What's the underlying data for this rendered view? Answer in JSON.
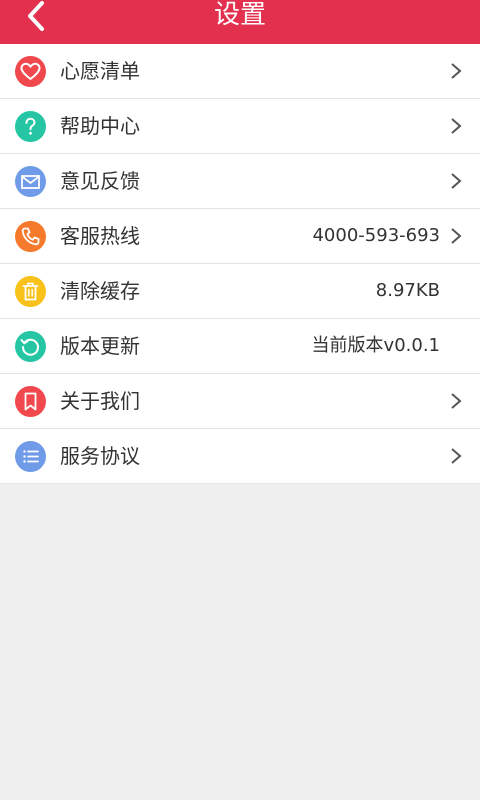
{
  "header": {
    "title": "设置",
    "back_icon": "chevron-left-icon",
    "background_color": "#e3304f"
  },
  "settings": {
    "items": [
      {
        "label": "心愿清单",
        "value": "",
        "icon": "heart-icon",
        "color": "#f0484c",
        "has_chevron": true
      },
      {
        "label": "帮助中心",
        "value": "",
        "icon": "question-icon",
        "color": "#26c6a4",
        "has_chevron": true
      },
      {
        "label": "意见反馈",
        "value": "",
        "icon": "mail-icon",
        "color": "#6f9be8",
        "has_chevron": true
      },
      {
        "label": "客服热线",
        "value": "4000-593-693",
        "icon": "phone-icon",
        "color": "#f57a2b",
        "has_chevron": true
      },
      {
        "label": "清除缓存",
        "value": "8.97KB",
        "icon": "trash-icon",
        "color": "#f8c21a",
        "has_chevron": false
      },
      {
        "label": "版本更新",
        "value": "当前版本v0.0.1",
        "icon": "refresh-icon",
        "color": "#26c6a4",
        "has_chevron": false
      },
      {
        "label": "关于我们",
        "value": "",
        "icon": "bookmark-icon",
        "color": "#f0484c",
        "has_chevron": true
      },
      {
        "label": "服务协议",
        "value": "",
        "icon": "list-icon",
        "color": "#6f9be8",
        "has_chevron": true
      }
    ]
  }
}
